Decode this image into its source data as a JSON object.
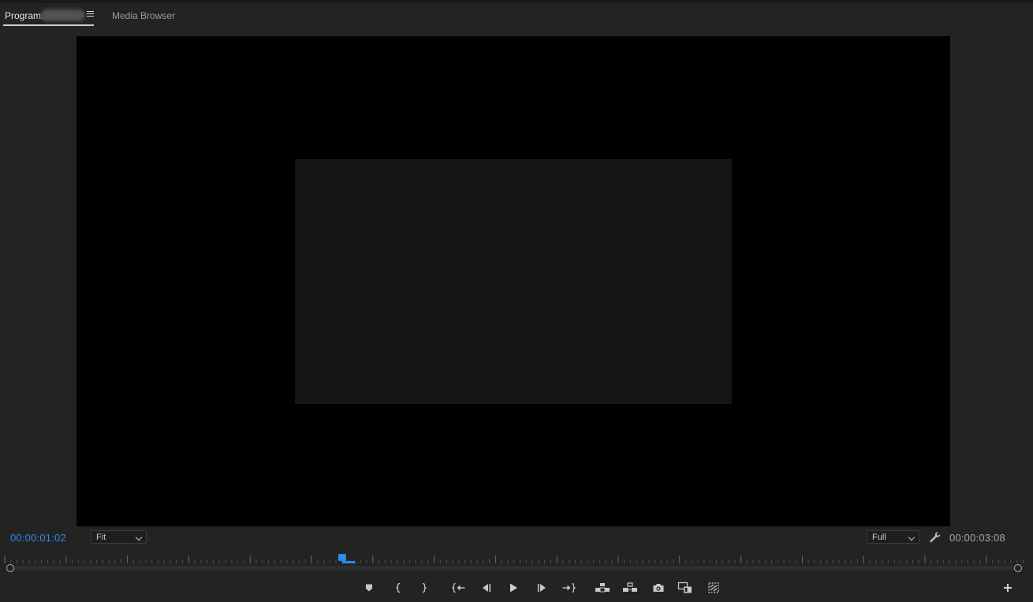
{
  "panel": {
    "tabs": [
      {
        "label": "Program:",
        "active": true
      },
      {
        "label": "Media Browser",
        "active": false
      }
    ]
  },
  "status": {
    "current_timecode": "00:00:01:02",
    "duration_timecode": "00:00:03:08",
    "zoom": {
      "selected": "Fit"
    },
    "resolution": {
      "selected": "Full"
    }
  },
  "scrubber": {
    "playhead_fraction": 0.33
  },
  "transport": {
    "buttons": [
      {
        "name": "add-marker-button",
        "icon": "marker-icon"
      },
      {
        "name": "mark-in-button",
        "icon": "mark-in-icon"
      },
      {
        "name": "mark-out-button",
        "icon": "mark-out-icon"
      },
      {
        "name": "go-to-in-button",
        "icon": "go-to-in-icon"
      },
      {
        "name": "step-back-button",
        "icon": "step-back-icon"
      },
      {
        "name": "play-button",
        "icon": "play-icon"
      },
      {
        "name": "step-forward-button",
        "icon": "step-forward-icon"
      },
      {
        "name": "go-to-out-button",
        "icon": "go-to-out-icon"
      },
      {
        "name": "lift-button",
        "icon": "lift-icon"
      },
      {
        "name": "extract-button",
        "icon": "extract-icon"
      },
      {
        "name": "export-frame-button",
        "icon": "camera-icon"
      },
      {
        "name": "comparison-view-button",
        "icon": "comparison-view-icon"
      },
      {
        "name": "toggle-proxies-button",
        "icon": "proxy-icon"
      }
    ]
  },
  "colors": {
    "panel_bg": "#232323",
    "timecode_accent": "#2d8ceb",
    "monitor_bg": "#000000"
  }
}
